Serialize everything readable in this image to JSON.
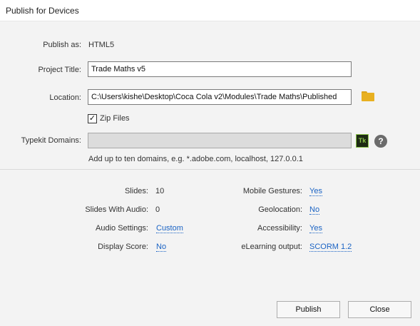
{
  "window": {
    "title": "Publish for Devices"
  },
  "form": {
    "publish_as_label": "Publish as:",
    "publish_as_value": "HTML5",
    "project_title_label": "Project Title:",
    "project_title_value": "Trade Maths v5",
    "location_label": "Location:",
    "location_value": "C:\\Users\\kishe\\Desktop\\Coca Cola v2\\Modules\\Trade Maths\\Published",
    "zip_files_label": "Zip Files",
    "zip_files_checked": true,
    "zip_files_mark": "✓",
    "typekit_label": "Typekit Domains:",
    "typekit_value": "",
    "typekit_icon_text": "Tk",
    "help_icon_text": "?",
    "typekit_hint": "Add up to ten domains, e.g. *.adobe.com, localhost, 127.0.0.1"
  },
  "summary": {
    "slides_label": "Slides:",
    "slides_value": "10",
    "slides_audio_label": "Slides With Audio:",
    "slides_audio_value": "0",
    "audio_settings_label": "Audio Settings:",
    "audio_settings_value": "Custom",
    "display_score_label": "Display Score:",
    "display_score_value": "No",
    "mobile_gestures_label": "Mobile Gestures:",
    "mobile_gestures_value": "Yes",
    "geolocation_label": "Geolocation:",
    "geolocation_value": "No",
    "accessibility_label": "Accessibility:",
    "accessibility_value": "Yes",
    "elearning_label": "eLearning output:",
    "elearning_value": "SCORM 1.2"
  },
  "buttons": {
    "publish": "Publish",
    "close": "Close"
  },
  "colors": {
    "link": "#1a63c4",
    "folder": "#e8b020",
    "typekit": "#8bc34a"
  }
}
